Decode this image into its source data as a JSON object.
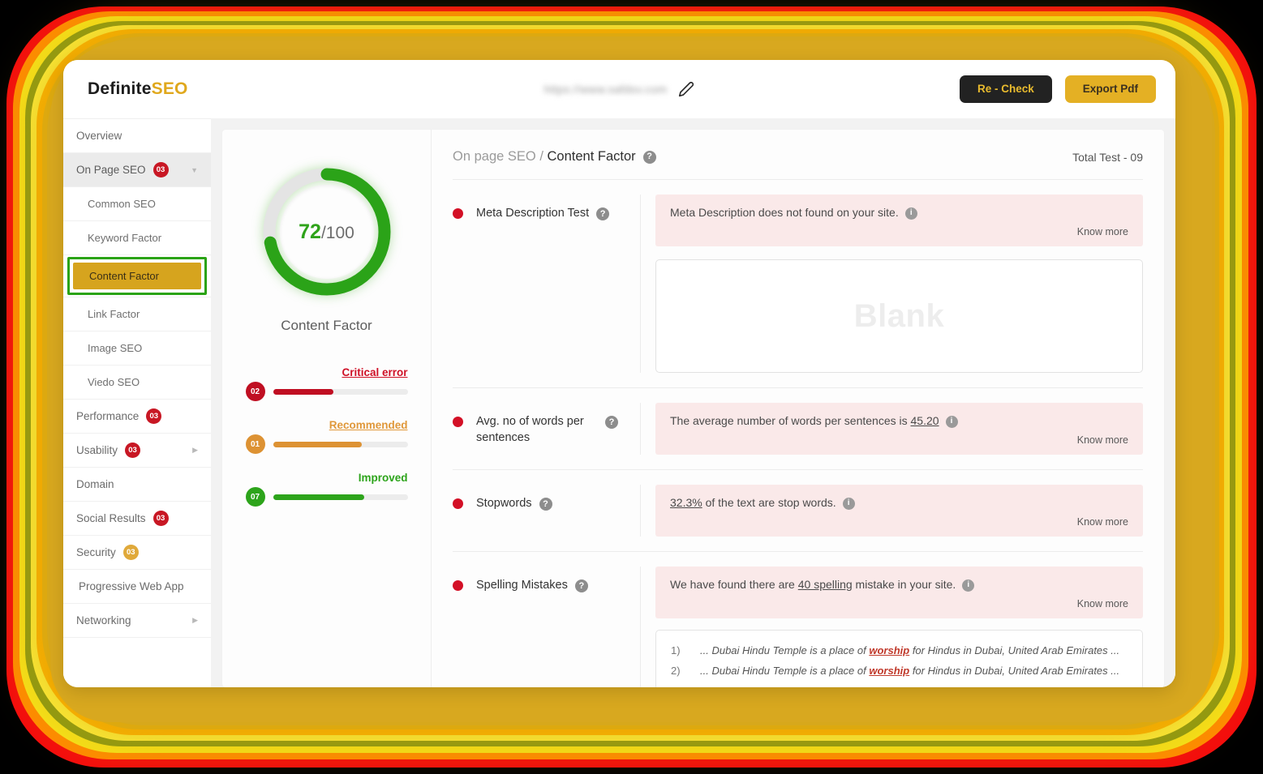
{
  "brand": {
    "name_dark": "Definite",
    "name_accent": "SEO",
    "accent_color": "#e0a81d"
  },
  "topbar": {
    "url_value": "https://www.safdsv.com",
    "edit_icon": "pencil-icon",
    "recheck_label": "Re - Check",
    "export_label": "Export Pdf"
  },
  "sidebar": {
    "items": [
      {
        "label": "Overview",
        "badge": null,
        "caret": null,
        "sub": false
      },
      {
        "label": "On Page SEO",
        "badge": "03",
        "badge_color": "red",
        "caret": "down",
        "sub": false,
        "active": true
      },
      {
        "label": "Common SEO",
        "badge": null,
        "caret": null,
        "sub": true
      },
      {
        "label": "Keyword Factor",
        "badge": null,
        "caret": null,
        "sub": true
      },
      {
        "label": "Content Factor",
        "badge": null,
        "caret": null,
        "sub": true,
        "selected": true
      },
      {
        "label": "Link Factor",
        "badge": null,
        "caret": null,
        "sub": true
      },
      {
        "label": "Image SEO",
        "badge": null,
        "caret": null,
        "sub": true
      },
      {
        "label": "Viedo SEO",
        "badge": null,
        "caret": null,
        "sub": true
      },
      {
        "label": "Performance",
        "badge": "03",
        "badge_color": "red",
        "caret": null,
        "sub": false
      },
      {
        "label": "Usability",
        "badge": "03",
        "badge_color": "red",
        "caret": "right",
        "sub": false
      },
      {
        "label": "Domain",
        "badge": null,
        "caret": null,
        "sub": false
      },
      {
        "label": "Social Results",
        "badge": "03",
        "badge_color": "red",
        "caret": null,
        "sub": false
      },
      {
        "label": "Security",
        "badge": "03",
        "badge_color": "gold",
        "caret": null,
        "sub": false
      },
      {
        "label": "Progressive Web App",
        "badge": null,
        "caret": null,
        "sub": false
      },
      {
        "label": "Networking",
        "badge": null,
        "caret": "right",
        "sub": false
      }
    ]
  },
  "gauge": {
    "score": "72",
    "max": "/100",
    "label": "Content Factor",
    "percent": 72,
    "arc_color": "#2ba318",
    "track_color": "#e4e4e4"
  },
  "legend": [
    {
      "count": "02",
      "title": "Critical error",
      "fill_percent": 45,
      "color": "#c00f22",
      "cls": "crit"
    },
    {
      "count": "01",
      "title": "Recommended",
      "fill_percent": 66,
      "color": "#dd9233",
      "cls": "rec"
    },
    {
      "count": "07",
      "title": "Improved",
      "fill_percent": 68,
      "color": "#2da41b",
      "cls": "imp"
    }
  ],
  "content": {
    "breadcrumb_parent": "On page SEO / ",
    "breadcrumb_current": "Content Factor",
    "breadcrumb_help_icon": "question-mark-icon",
    "total_test": "Total Test - 09",
    "know_more": "Know more",
    "blank_placeholder": "Blank",
    "tests": [
      {
        "name": "Meta Description Test",
        "status": "critical",
        "message_pre": "Meta Description does not found on your site.",
        "message_link": "",
        "message_post": ""
      },
      {
        "name": "Avg. no of words per sentences",
        "status": "critical",
        "message_pre": "The average number of words per sentences is ",
        "message_link": "45.20",
        "message_post": ""
      },
      {
        "name": "Stopwords",
        "status": "critical",
        "message_pre": "",
        "message_link": "32.3%",
        "message_post": " of the text are stop words."
      },
      {
        "name": "Spelling Mistakes",
        "status": "critical",
        "message_pre": "We have found there are ",
        "message_link": "40 spelling",
        "message_post": " mistake in your site."
      }
    ],
    "spelling_examples": [
      {
        "num": "1)",
        "pre": "... Dubai Hindu Temple is a place of ",
        "word": "worship",
        "post": " for Hindus in Dubai, United Arab Emirates ..."
      },
      {
        "num": "2)",
        "pre": "... Dubai Hindu Temple is a place of ",
        "word": "worship",
        "post": " for Hindus in Dubai, United Arab Emirates ..."
      }
    ]
  }
}
